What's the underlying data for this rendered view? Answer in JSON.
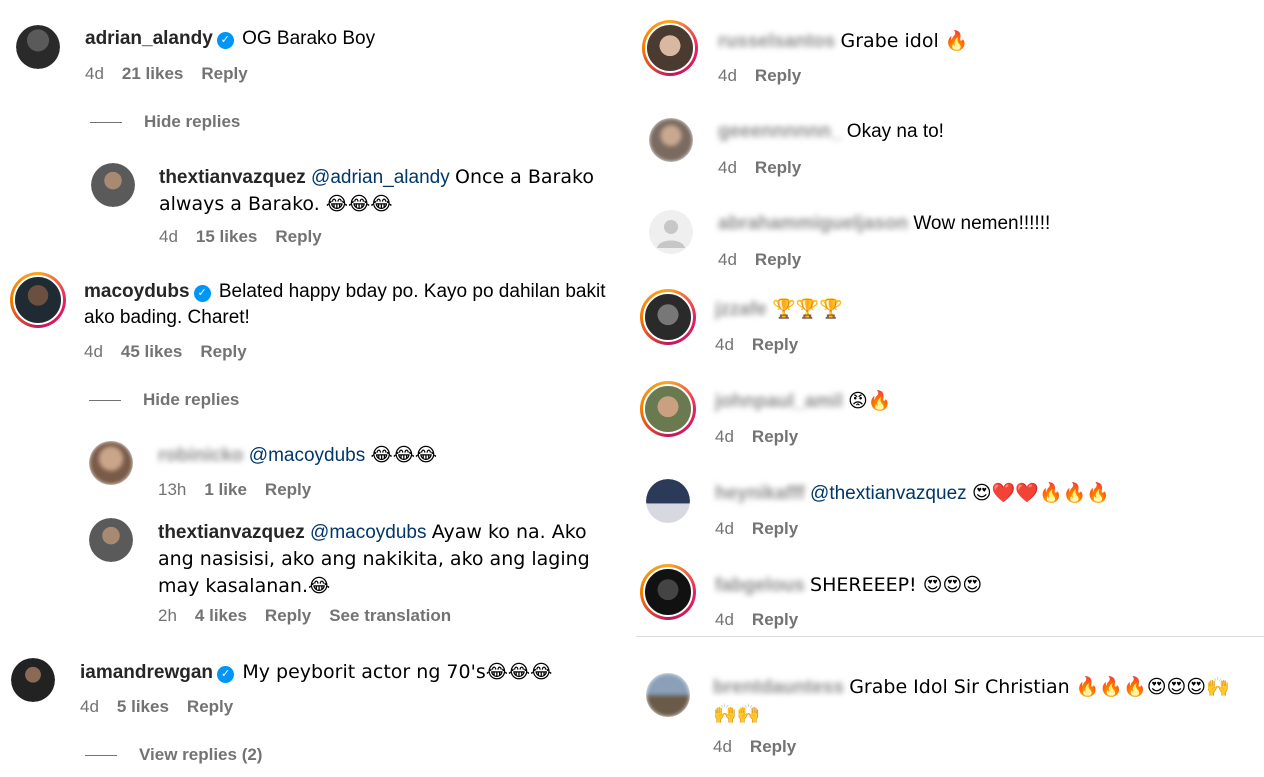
{
  "left": {
    "c1": {
      "user": "adrian_alandy",
      "text": "OG Barako Boy",
      "time": "4d",
      "likes": "21 likes",
      "reply": "Reply",
      "toggle": "Hide replies"
    },
    "c1r1": {
      "user": "thextianvazquez",
      "mention": "@adrian_alandy",
      "text": "Once a Barako always a Barako. 😂😂😂",
      "time": "4d",
      "likes": "15 likes",
      "reply": "Reply"
    },
    "c2": {
      "user": "macoydubs",
      "text": "Belated happy bday po. Kayo po dahilan bakit ako bading. Charet!",
      "time": "4d",
      "likes": "45 likes",
      "reply": "Reply",
      "toggle": "Hide replies"
    },
    "c2r1": {
      "user": "robinicko",
      "mention": "@macoydubs",
      "text": "😂😂😂",
      "time": "13h",
      "likes": "1 like",
      "reply": "Reply"
    },
    "c2r2": {
      "user": "thextianvazquez",
      "mention": "@macoydubs",
      "text": "Ayaw ko na. Ako ang nasisisi, ako ang nakikita, ako ang laging may kasalanan.😂",
      "time": "2h",
      "likes": "4 likes",
      "reply": "Reply",
      "translate": "See translation"
    },
    "c3": {
      "user": "iamandrewgan",
      "text": "My peyborit actor ng 70's😂😂😂",
      "time": "4d",
      "likes": "5 likes",
      "reply": "Reply",
      "toggle": "View replies (2)"
    }
  },
  "right": {
    "r1": {
      "user": "russelsantos",
      "text": "Grabe idol 🔥",
      "time": "4d",
      "reply": "Reply"
    },
    "r2": {
      "user": "geeennnnnn_",
      "text": "Okay na to!",
      "time": "4d",
      "reply": "Reply"
    },
    "r3": {
      "user": "abrahammigueljason",
      "text": "Wow nemen!!!!!!",
      "time": "4d",
      "reply": "Reply"
    },
    "r4": {
      "user": "jzzafe",
      "text": "🏆🏆🏆",
      "time": "4d",
      "reply": "Reply"
    },
    "r5": {
      "user": "johnpaul_amil",
      "text": "😡🔥",
      "time": "4d",
      "reply": "Reply"
    },
    "r6": {
      "user": "heynikafff",
      "mention": "@thextianvazquez",
      "text": "😍❤️❤️🔥🔥🔥",
      "time": "4d",
      "reply": "Reply"
    },
    "r7": {
      "user": "fabgelous",
      "text": "SHEREEEP! 😍😍😍",
      "time": "4d",
      "reply": "Reply"
    },
    "r8": {
      "user": "brentdauntess",
      "text": "Grabe Idol Sir Christian 🔥🔥🔥😍😍😍🙌🙌🙌",
      "time": "4d",
      "reply": "Reply"
    }
  },
  "colors": {
    "link": "#00376b",
    "meta": "#737373",
    "verified": "#0095f6"
  }
}
